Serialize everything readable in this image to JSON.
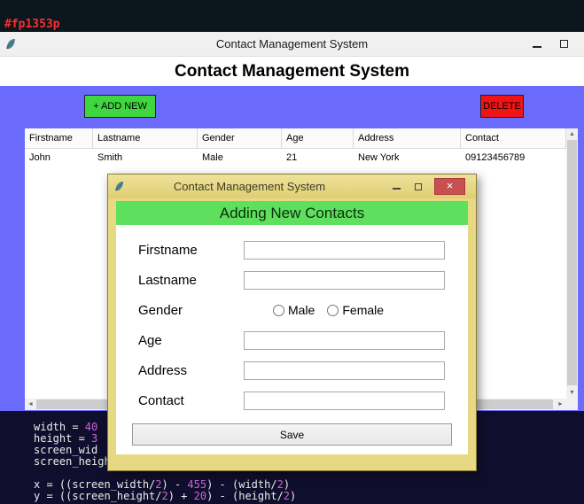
{
  "colors": {
    "body_blue": "#6a6afb",
    "add_button_green": "#3fd63f",
    "delete_button_red": "#f01414",
    "dialog_khaki": "#e7d883",
    "dialog_header_green": "#5ee05e",
    "close_button_red": "#c75050",
    "code_background": "#0f0f2d",
    "code_number_purple": "#c766d9",
    "code_red_text": "#ff2d2d"
  },
  "icons": {
    "app_icon": "feather",
    "scroll_up": "▲",
    "scroll_down": "▼",
    "scroll_left": "◄",
    "scroll_right": "►",
    "close": "×"
  },
  "desktop": {
    "top_code_text": "#fp1353p"
  },
  "main_window": {
    "titlebar": {
      "title": "Contact Management System"
    },
    "header": "Contact Management System",
    "toolbar": {
      "add_label": "+ ADD NEW",
      "delete_label": "DELETE"
    },
    "table": {
      "columns": [
        "Firstname",
        "Lastname",
        "Gender",
        "Age",
        "Address",
        "Contact"
      ],
      "rows": [
        [
          "John",
          "Smith",
          "Male",
          "21",
          "New York",
          "09123456789"
        ]
      ]
    }
  },
  "dialog": {
    "titlebar": {
      "title": "Contact Management System"
    },
    "header": "Adding New Contacts",
    "fields": {
      "firstname": {
        "label": "Firstname",
        "value": "",
        "placeholder": ""
      },
      "lastname": {
        "label": "Lastname",
        "value": "",
        "placeholder": ""
      },
      "gender": {
        "label": "Gender",
        "options": [
          "Male",
          "Female"
        ],
        "selected": ""
      },
      "age": {
        "label": "Age",
        "value": "",
        "placeholder": ""
      },
      "address": {
        "label": "Address",
        "value": "",
        "placeholder": ""
      },
      "contact": {
        "label": "Contact",
        "value": "",
        "placeholder": ""
      }
    },
    "save_label": "Save"
  },
  "code_editor": {
    "lines": [
      "width = 40",
      "height = 3",
      "screen_wid",
      "screen_heigh",
      "",
      "x = ((screen_width/2) - 455) - (width/2)",
      "y = ((screen_height/2) + 20) - (height/2)"
    ]
  }
}
